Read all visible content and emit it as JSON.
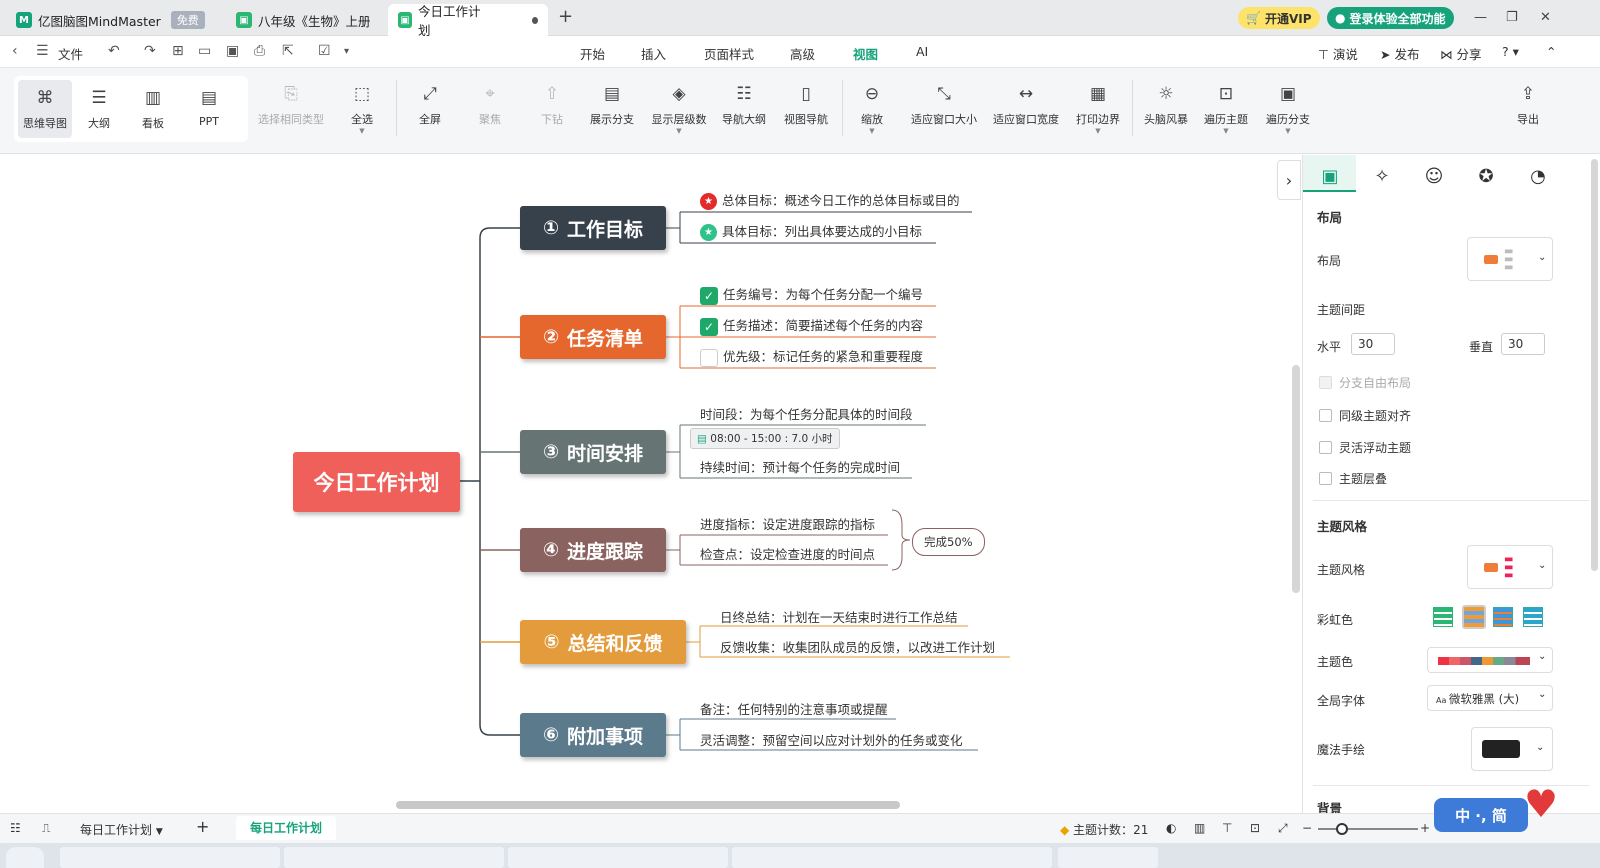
{
  "tabs": [
    {
      "label": "亿图脑图MindMaster",
      "badge": "免费"
    },
    {
      "label": "八年级《生物》上册"
    },
    {
      "label": "今日工作计划"
    }
  ],
  "topright": {
    "vip": "开通VIP",
    "login": "登录体验全部功能"
  },
  "menu": {
    "file": "文件",
    "items": [
      "开始",
      "插入",
      "页面样式",
      "高级",
      "视图",
      "AI"
    ],
    "active": "视图",
    "right": [
      "演说",
      "发布",
      "分享"
    ]
  },
  "ribbon": {
    "views": [
      "思维导图",
      "大纲",
      "看板",
      "PPT"
    ],
    "tools": [
      "选择相同类型",
      "全选",
      "全屏",
      "聚焦",
      "下钻",
      "展示分支",
      "显示层级数",
      "导航大纲",
      "视图导航",
      "缩放",
      "适应窗口大小",
      "适应窗口宽度",
      "打印边界",
      "头脑风暴",
      "遍历主题",
      "遍历分支"
    ],
    "export": "导出"
  },
  "mindmap": {
    "root": "今日工作计划",
    "branches": [
      {
        "num": "①",
        "title": "工作目标",
        "color": "#37414c",
        "subs": [
          "总体目标：概述今日工作的总体目标或目的",
          "具体目标：列出具体要达成的小目标"
        ]
      },
      {
        "num": "②",
        "title": "任务清单",
        "color": "#e5672e",
        "subs": [
          "任务编号：为每个任务分配一个编号",
          "任务描述：简要描述每个任务的内容",
          "优先级：标记任务的紧急和重要程度"
        ]
      },
      {
        "num": "③",
        "title": "时间安排",
        "color": "#667574",
        "subs": [
          "时间段：为每个任务分配具体的时间段",
          "持续时间：预计每个任务的完成时间"
        ],
        "tag": "08:00 - 15:00 : 7.0 小时"
      },
      {
        "num": "④",
        "title": "进度跟踪",
        "color": "#8a6361",
        "subs": [
          "进度指标：设定进度跟踪的指标",
          "检查点：设定检查进度的时间点"
        ],
        "summary": "完成50%"
      },
      {
        "num": "⑤",
        "title": "总结和反馈",
        "color": "#e39b3b",
        "subs": [
          "日终总结：计划在一天结束时进行工作总结",
          "反馈收集：收集团队成员的反馈，以改进工作计划"
        ]
      },
      {
        "num": "⑥",
        "title": "附加事项",
        "color": "#5b7a8c",
        "subs": [
          "备注：任何特别的注意事项或提醒",
          "灵活调整：预留空间以应对计划外的任务或变化"
        ]
      }
    ]
  },
  "panel": {
    "layout_title": "布局",
    "layout_label": "布局",
    "spacing": "主题间距",
    "h_label": "水平",
    "h_val": "30",
    "v_label": "垂直",
    "v_val": "30",
    "checks": [
      "分支自由布局",
      "同级主题对齐",
      "灵活浮动主题",
      "主题层叠"
    ],
    "style_title": "主题风格",
    "style_label": "主题风格",
    "rainbow": "彩虹色",
    "theme_color": "主题色",
    "font_label": "全局字体",
    "font_val": "微软雅黑 (大)",
    "magic": "魔法手绘",
    "bg": "背景"
  },
  "status": {
    "sheet": "每日工作计划",
    "sheet_tab": "每日工作计划",
    "count_label": "主题计数：",
    "count": "21"
  },
  "ime": "中 ·, 简",
  "colors": {
    "accent": "#16a37b",
    "root": "#f0605a"
  }
}
